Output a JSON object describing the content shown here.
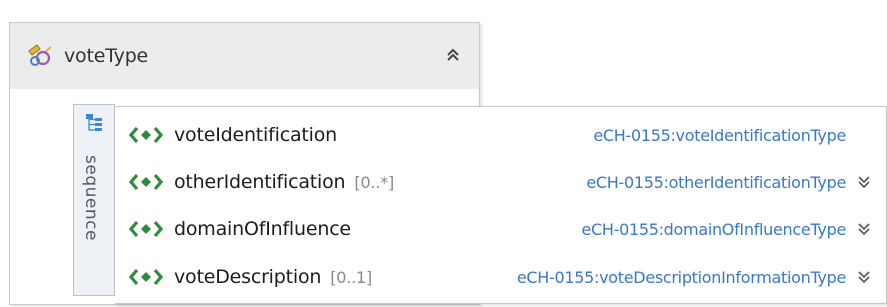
{
  "complex_type": {
    "name": "voteType",
    "icon": "complex-type-icon",
    "collapse_icon": "double-chevron-up-icon"
  },
  "sequence": {
    "label": "sequence",
    "icon": "sequence-icon"
  },
  "elements": [
    {
      "name": "voteIdentification",
      "cardinality": "",
      "type": "eCH-0155:voteIdentificationType",
      "expandable": false
    },
    {
      "name": "otherIdentification",
      "cardinality": "[0..*]",
      "type": "eCH-0155:otherIdentificationType",
      "expandable": true
    },
    {
      "name": "domainOfInfluence",
      "cardinality": "",
      "type": "eCH-0155:domainOfInfluenceType",
      "expandable": true
    },
    {
      "name": "voteDescription",
      "cardinality": "[0..1]",
      "type": "eCH-0155:voteDescriptionInformationType",
      "expandable": true
    }
  ],
  "element_icon": "element-icon",
  "expand_icon": "double-chevron-down-icon",
  "colors": {
    "header_bg": "#ececec",
    "type_link": "#3a78c6",
    "element_icon": "#2e8b3a",
    "sequence_bg": "#eef1f6"
  }
}
